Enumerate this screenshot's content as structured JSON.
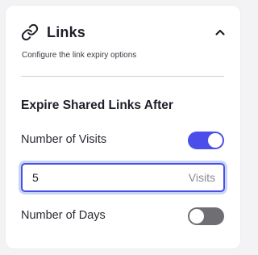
{
  "panel": {
    "title": "Links",
    "subtitle": "Configure the link expiry options",
    "icon": "link-icon",
    "collapse_icon": "chevron-up-icon"
  },
  "section": {
    "title": "Expire Shared Links After"
  },
  "visits": {
    "label": "Number of Visits",
    "enabled": true,
    "value": "5",
    "unit": "Visits"
  },
  "days": {
    "label": "Number of Days",
    "enabled": false
  },
  "colors": {
    "accent": "#4b4ee8",
    "toggle_off": "#6e6e73",
    "focus_ring": "#c8d6f5"
  }
}
